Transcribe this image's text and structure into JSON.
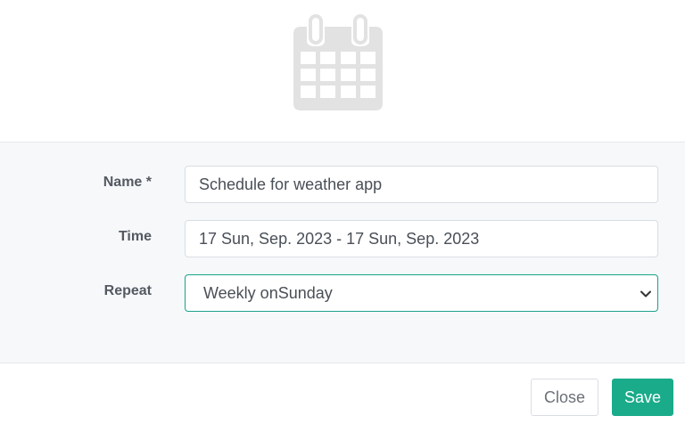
{
  "form": {
    "name": {
      "label": "Name *",
      "value": "Schedule for weather app"
    },
    "time": {
      "label": "Time",
      "value": "17 Sun, Sep. 2023 - 17 Sun, Sep. 2023"
    },
    "repeat": {
      "label": "Repeat",
      "selected": "Weekly onSunday"
    }
  },
  "footer": {
    "close_label": "Close",
    "save_label": "Save"
  },
  "colors": {
    "accent": "#1aab8a",
    "icon": "#e2e2e2"
  },
  "icons": {
    "header": "calendar-icon",
    "select": "chevron-down-icon"
  }
}
